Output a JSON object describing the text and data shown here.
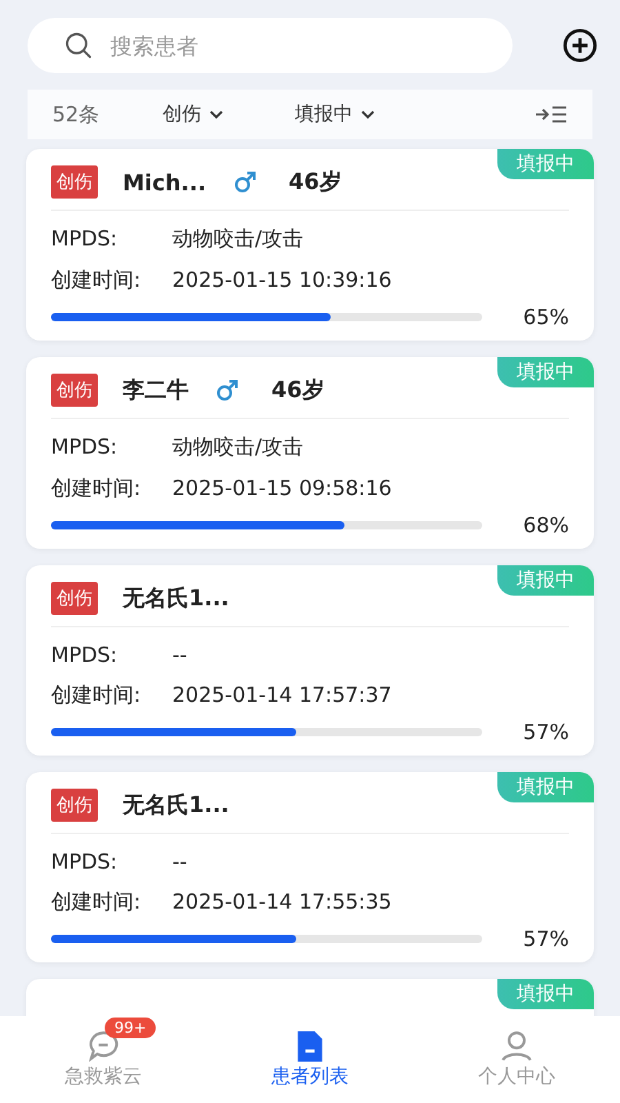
{
  "search": {
    "placeholder": "搜索患者"
  },
  "filters": {
    "count": "52条",
    "type": "创伤",
    "status": "填报中"
  },
  "patients": [
    {
      "tag": "创伤",
      "name": "Mich...",
      "kind": "male",
      "age": "46岁",
      "status": "填报中",
      "mpds_label": "MPDS:",
      "mpds": "动物咬击/攻击",
      "time_label": "创建时间:",
      "time": "2025-01-15 10:39:16",
      "level": 0.65,
      "percent": "65%"
    },
    {
      "tag": "创伤",
      "name": "李二牛",
      "kind": "male",
      "age": "46岁",
      "status": "填报中",
      "mpds_label": "MPDS:",
      "mpds": "动物咬击/攻击",
      "time_label": "创建时间:",
      "time": "2025-01-15 09:58:16",
      "level": 0.68,
      "percent": "68%"
    },
    {
      "tag": "创伤",
      "name": "无名氏1...",
      "status": "填报中",
      "mpds_label": "MPDS:",
      "mpds": "--",
      "time_label": "创建时间:",
      "time": "2025-01-14 17:57:37",
      "level": 0.57,
      "percent": "57%"
    },
    {
      "tag": "创伤",
      "name": "无名氏1...",
      "status": "填报中",
      "mpds_label": "MPDS:",
      "mpds": "--",
      "time_label": "创建时间:",
      "time": "2025-01-14 17:55:35",
      "level": 0.57,
      "percent": "57%"
    },
    {
      "status": "填报中"
    }
  ],
  "tabbar": [
    {
      "label": "急救紫云",
      "kind": "chat",
      "badge": "99+",
      "selected": false
    },
    {
      "label": "患者列表",
      "kind": "doc",
      "selected": true
    },
    {
      "label": "个人中心",
      "kind": "person",
      "selected": false
    }
  ]
}
